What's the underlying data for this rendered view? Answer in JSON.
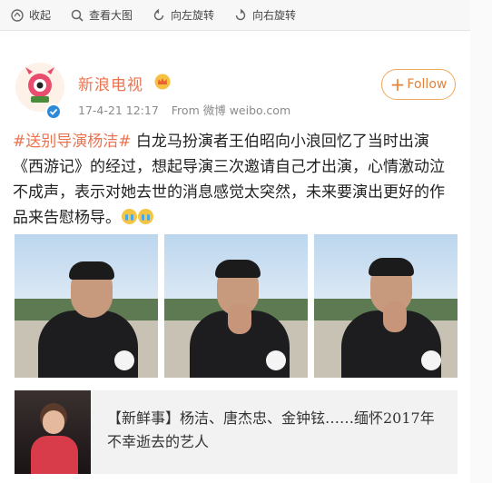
{
  "toolbar": {
    "collapse_label": "收起",
    "view_large_label": "查看大图",
    "rotate_left_label": "向左旋转",
    "rotate_right_label": "向右旋转"
  },
  "post": {
    "username": "新浪电视",
    "timestamp": "17-4-21 12:17",
    "source": "From 微博 weibo.com",
    "follow_label": "Follow",
    "hashtag": "#送别导演杨洁#",
    "body": " 白龙马扮演者王伯昭向小浪回忆了当时出演《西游记》的经过，想起导演三次邀请自己才出演，心情激动泣不成声，表示对她去世的消息感觉太突然，未来要演出更好的作品来告慰杨导。",
    "emoji_icons": [
      "crying-face-icon",
      "crying-face-icon"
    ]
  },
  "article": {
    "title": "【新鲜事】杨洁、唐杰忠、金钟铉……缅怀2017年不幸逝去的艺人"
  },
  "colors": {
    "brand_orange": "#eb7350",
    "follow_border": "#f0a85a",
    "verified_blue": "#2c8ad8"
  }
}
